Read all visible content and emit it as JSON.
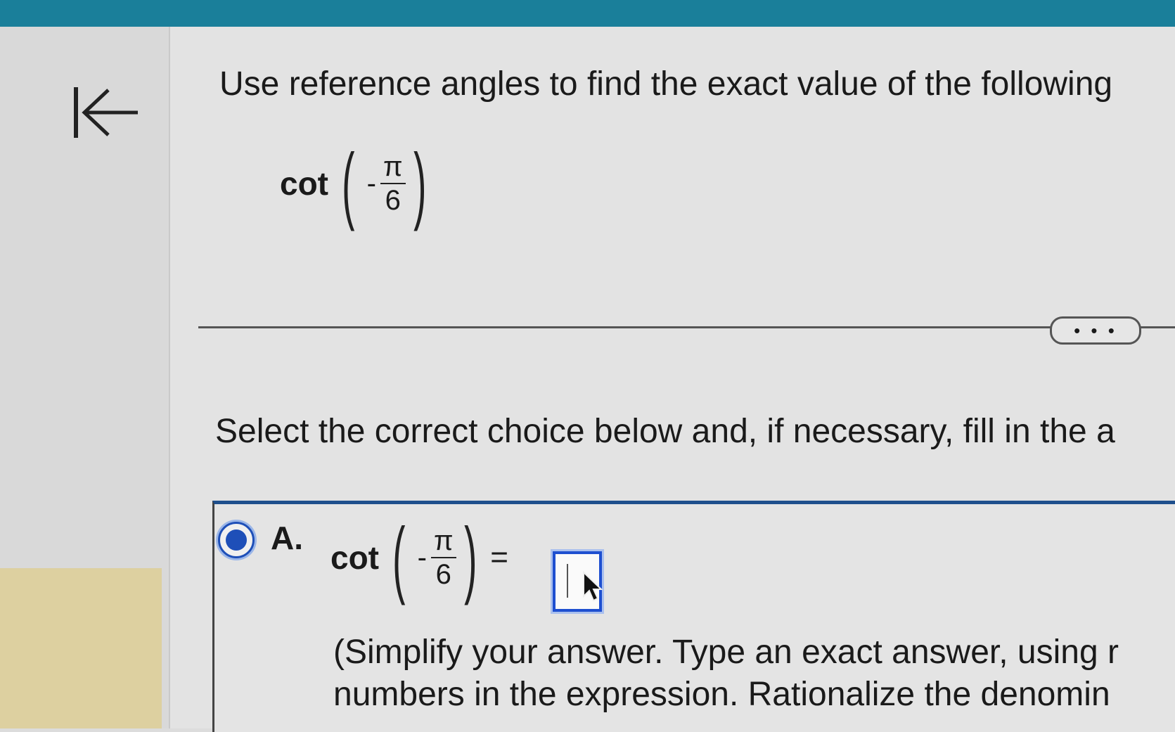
{
  "question": {
    "prompt": "Use reference angles to find the exact value of the following",
    "expression": {
      "function": "cot",
      "sign": "-",
      "numerator": "π",
      "denominator": "6"
    }
  },
  "more_button": {
    "label": "• • •"
  },
  "instruction": "Select the correct choice below and, if necessary, fill in the a",
  "choice_a": {
    "label": "A.",
    "selected": true,
    "expression": {
      "function": "cot",
      "sign": "-",
      "numerator": "π",
      "denominator": "6",
      "equals": "="
    },
    "answer_value": "",
    "hint_line1": "(Simplify your answer. Type an exact answer, using r",
    "hint_line2": "numbers in the expression. Rationalize the denomin"
  },
  "icons": {
    "back": "back-arrow-to-start-icon",
    "cursor": "mouse-pointer-icon"
  },
  "colors": {
    "topbar": "#1a7f9a",
    "accent": "#1e4fb8",
    "panel_yellow": "#ddd0a0"
  }
}
